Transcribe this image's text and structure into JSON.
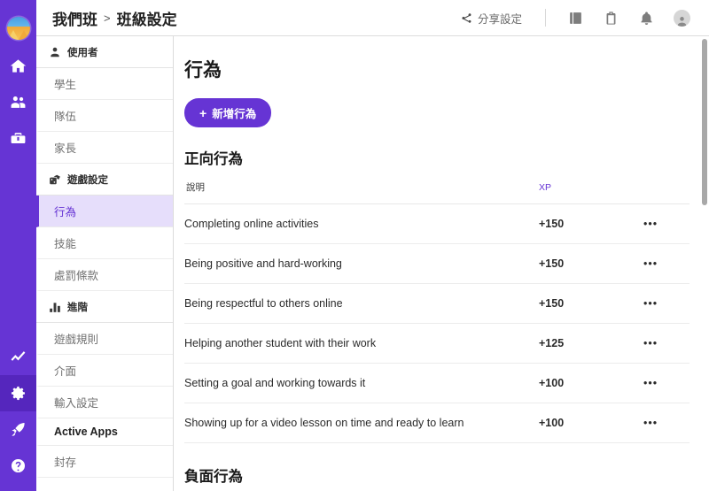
{
  "rail": {
    "logo_name": "classcraft-mountain-logo",
    "top_items": [
      {
        "name": "home-icon",
        "label": "Home",
        "active": false
      },
      {
        "name": "students-icon",
        "label": "Students",
        "active": false
      },
      {
        "name": "toolkit-icon",
        "label": "Toolkit",
        "active": false
      }
    ],
    "bottom_items": [
      {
        "name": "analytics-icon",
        "label": "Analytics",
        "active": false
      },
      {
        "name": "settings-gear-icon",
        "label": "Settings",
        "active": true
      },
      {
        "name": "rocket-icon",
        "label": "Quests",
        "active": false
      },
      {
        "name": "help-icon",
        "label": "Help",
        "active": false
      }
    ]
  },
  "header": {
    "breadcrumb": {
      "root": "我們班",
      "separator": ">",
      "current": "班級設定"
    },
    "share_label": "分享設定",
    "icons": [
      {
        "name": "news-book-icon"
      },
      {
        "name": "clipboard-checklist-icon"
      },
      {
        "name": "notifications-bell-icon"
      },
      {
        "name": "user-avatar-icon"
      }
    ]
  },
  "sidebar": {
    "groups": [
      {
        "section": {
          "label": "使用者",
          "icon": "user-icon"
        },
        "items": [
          {
            "label": "學生",
            "active": false,
            "strong": false
          },
          {
            "label": "隊伍",
            "active": false,
            "strong": false
          },
          {
            "label": "家長",
            "active": false,
            "strong": false
          }
        ]
      },
      {
        "section": {
          "label": "遊戲設定",
          "icon": "dice-icon"
        },
        "items": [
          {
            "label": "行為",
            "active": true,
            "strong": false
          },
          {
            "label": "技能",
            "active": false,
            "strong": false
          },
          {
            "label": "處罰條款",
            "active": false,
            "strong": false
          }
        ]
      },
      {
        "section": {
          "label": "進階",
          "icon": "bar-chart-icon"
        },
        "items": [
          {
            "label": "遊戲規則",
            "active": false,
            "strong": false
          },
          {
            "label": "介面",
            "active": false,
            "strong": false
          },
          {
            "label": "輸入設定",
            "active": false,
            "strong": false
          },
          {
            "label": "Active Apps",
            "active": false,
            "strong": true
          },
          {
            "label": "封存",
            "active": false,
            "strong": false
          }
        ]
      }
    ]
  },
  "main": {
    "page_title": "行為",
    "add_button": {
      "plus": "+",
      "label": "新增行為"
    },
    "positive_section_title": "正向行為",
    "negative_section_title": "負面行為",
    "columns": {
      "description": "說明",
      "xp": "XP",
      "menu": ""
    },
    "menu_glyph": "•••",
    "positive_rows": [
      {
        "description": "Completing online activities",
        "xp": "+150"
      },
      {
        "description": "Being positive and hard-working",
        "xp": "+150"
      },
      {
        "description": "Being respectful to others online",
        "xp": "+150"
      },
      {
        "description": "Helping another student with their work",
        "xp": "+125"
      },
      {
        "description": "Setting a goal and working towards it",
        "xp": "+100"
      },
      {
        "description": "Showing up for a video lesson on time and ready to learn",
        "xp": "+100"
      }
    ]
  },
  "colors": {
    "brand_purple": "#6634D4",
    "rail_active": "#5526BD",
    "xp_purple": "#5b2de0",
    "active_item_bg": "#e6deFB"
  }
}
